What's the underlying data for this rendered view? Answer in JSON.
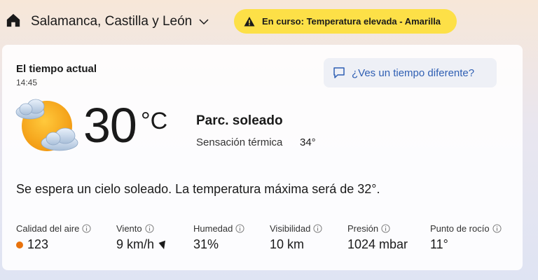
{
  "header": {
    "home_icon": "home-icon",
    "location": "Salamanca, Castilla y León",
    "alert_text": "En curso: Temperatura elevada - Amarilla",
    "alert_color": "#fde047"
  },
  "current": {
    "title": "El tiempo actual",
    "time": "14:45",
    "feedback_label": "¿Ves un tiempo diferente?",
    "weather_icon": "partly-sunny-icon",
    "temperature": "30",
    "unit": "°C",
    "condition": "Parc. soleado",
    "feels_like_label": "Sensación térmica",
    "feels_like_value": "34°",
    "summary": "Se espera un cielo soleado. La temperatura máxima será de 32°."
  },
  "metrics": [
    {
      "label": "Calidad del aire",
      "value": "123",
      "dot_color": "#e8720c"
    },
    {
      "label": "Viento",
      "value": "9 km/h"
    },
    {
      "label": "Humedad",
      "value": "31%"
    },
    {
      "label": "Visibilidad",
      "value": "10 km"
    },
    {
      "label": "Presión",
      "value": "1024 mbar"
    },
    {
      "label": "Punto de rocío",
      "value": "11°"
    }
  ]
}
